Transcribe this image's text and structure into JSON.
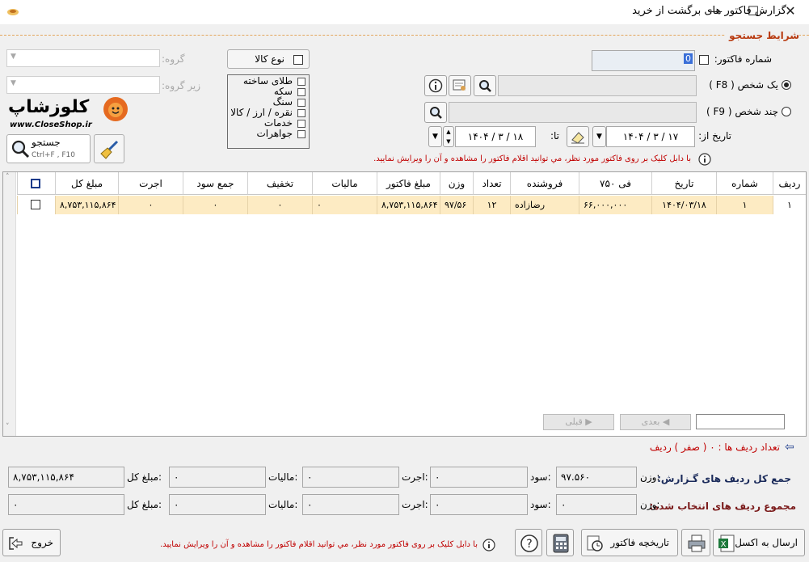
{
  "window": {
    "title": "گزارش فاکتور های برگشت از خرید",
    "controls": {
      "minimize": "—",
      "maximize": "☐",
      "close": "✕"
    }
  },
  "search": {
    "section_title": "شرایط جستجو",
    "invoice_number_label": "شماره فاکتور:",
    "invoice_number_value": "0",
    "one_person_label": "یک شخص ( F8 )",
    "many_persons_label": "چند شخص ( F9 )",
    "date_from_label": "تاریخ از:",
    "date_from": "۱۴۰۴ / ۳ / ۱۷",
    "date_to_label": "تا:",
    "date_to": "۱۴۰۴ / ۳ / ۱۸",
    "hint": "با دابل کلیک بر روی فاکتور مورد نظر، مي توانيد اقلام فاکتور را مشاهده و آن را ویرایش نمایید.",
    "goods_type_label": "نوع کالا",
    "goods_types": [
      "طلای ساخته",
      "سکه",
      "سنگ",
      "نقره / ارز / کالا",
      "خدمات",
      "جواهرات"
    ],
    "group_label": "گروه:",
    "subgroup_label": "زیر گروه:",
    "search_button_label": "جستجو",
    "search_button_shortcut": "Ctrl+F , F10"
  },
  "logo": {
    "brand": "کلوزشاپ",
    "url_text": "www.CloseShop.ir"
  },
  "table": {
    "columns": [
      "ردیف",
      "شماره",
      "تاریخ",
      "فی ۷۵۰",
      "فروشنده",
      "تعداد",
      "وزن",
      "مبلغ فاکتور",
      "مالیات",
      "تخفیف",
      "جمع سود",
      "اجرت",
      "مبلغ کل"
    ],
    "rows": [
      {
        "row": "۱",
        "number": "۱",
        "date": "۱۴۰۴/۰۳/۱۸",
        "fee750": "۶۶,۰۰۰,۰۰۰",
        "seller": "رضازاده",
        "count": "۱۲",
        "weight": "۹۷/۵۶",
        "invoice_amount": "۸,۷۵۳,۱۱۵,۸۶۴",
        "tax": "۰",
        "discount": "۰",
        "profit": "۰",
        "wage": "۰",
        "total": "۸,۷۵۳,۱۱۵,۸۶۴"
      }
    ],
    "next_label": "بعدی",
    "prev_label": "قبلی"
  },
  "summary": {
    "row_count_text": "تعداد ردیف ها : ۰ ( صفر ) ردیف",
    "report_total_label": "جمع کل ردیف های گـزارش:",
    "selected_total_label": "مجموع ردیف های انتخاب شده:",
    "weight_label": "وزن:",
    "profit_label": "سود:",
    "wage_label": "اجرت:",
    "tax_label": "مالیات:",
    "total_label": "مبلغ کل:",
    "report": {
      "weight": "۹۷.۵۶۰",
      "profit": "۰",
      "wage": "۰",
      "tax": "۰",
      "total": "۸,۷۵۳,۱۱۵,۸۶۴"
    },
    "selected": {
      "weight": "۰",
      "profit": "۰",
      "wage": "۰",
      "tax": "۰",
      "total": "۰"
    }
  },
  "footer": {
    "excel_label": "ارسال به اکسل",
    "history_label": "تاریخچه فاکتور",
    "exit_label": "خروج",
    "hint": "با دابل کلیک بر روی فاکتور مورد نظر، مي توانيد اقلام فاکتور را مشاهده و آن را ویرایش نمایید."
  },
  "colors": {
    "selected_row": "#fdebc3",
    "accent_red": "#c00000",
    "section_title": "#b83a10"
  }
}
